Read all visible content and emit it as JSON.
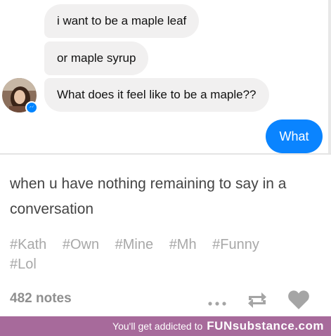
{
  "chat": {
    "messages": [
      "i want to be a maple leaf",
      "or maple syrup",
      "What does it feel like to be a maple??"
    ],
    "reply": "What"
  },
  "post": {
    "caption": "when u have nothing remaining to say in a conversation",
    "tags": [
      "#Kath",
      "#Own",
      "#Mine",
      "#Mh",
      "#Funny",
      "#Lol"
    ],
    "notes": "482 notes"
  },
  "icons": {
    "more": "more-dots-icon",
    "reblog": "reblog-icon",
    "like": "heart-icon"
  },
  "footer": {
    "text": "You'll get addicted to",
    "brand": "FUNsubstance.com"
  }
}
